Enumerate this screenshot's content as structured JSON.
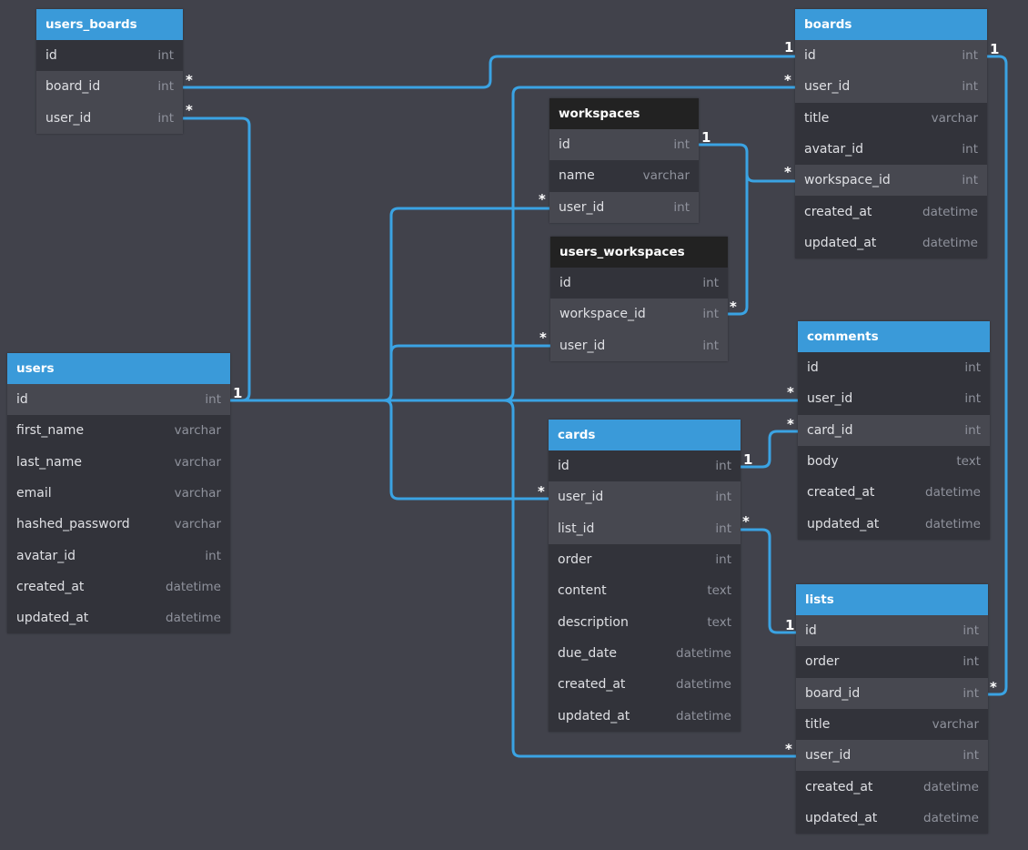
{
  "colors": {
    "background": "#41424b",
    "connector": "#3aa3e3",
    "header_blue": "#3a9ad9",
    "header_dark": "#222222",
    "row_dark": "#32333a",
    "row_light": "#474850"
  },
  "tables": [
    {
      "id": "users_boards",
      "title": "users_boards",
      "header": "blue",
      "fields": [
        {
          "name": "id",
          "type": "int",
          "shade": "dark"
        },
        {
          "name": "board_id",
          "type": "int",
          "shade": "light"
        },
        {
          "name": "user_id",
          "type": "int",
          "shade": "light"
        }
      ]
    },
    {
      "id": "boards",
      "title": "boards",
      "header": "blue",
      "fields": [
        {
          "name": "id",
          "type": "int",
          "shade": "light"
        },
        {
          "name": "user_id",
          "type": "int",
          "shade": "light"
        },
        {
          "name": "title",
          "type": "varchar",
          "shade": "dark"
        },
        {
          "name": "avatar_id",
          "type": "int",
          "shade": "dark"
        },
        {
          "name": "workspace_id",
          "type": "int",
          "shade": "light"
        },
        {
          "name": "created_at",
          "type": "datetime",
          "shade": "dark"
        },
        {
          "name": "updated_at",
          "type": "datetime",
          "shade": "dark"
        }
      ]
    },
    {
      "id": "workspaces",
      "title": "workspaces",
      "header": "dark",
      "fields": [
        {
          "name": "id",
          "type": "int",
          "shade": "light"
        },
        {
          "name": "name",
          "type": "varchar",
          "shade": "dark"
        },
        {
          "name": "user_id",
          "type": "int",
          "shade": "light"
        }
      ]
    },
    {
      "id": "users_workspaces",
      "title": "users_workspaces",
      "header": "dark",
      "fields": [
        {
          "name": "id",
          "type": "int",
          "shade": "dark"
        },
        {
          "name": "workspace_id",
          "type": "int",
          "shade": "light"
        },
        {
          "name": "user_id",
          "type": "int",
          "shade": "light"
        }
      ]
    },
    {
      "id": "users",
      "title": "users",
      "header": "blue",
      "fields": [
        {
          "name": "id",
          "type": "int",
          "shade": "light"
        },
        {
          "name": "first_name",
          "type": "varchar",
          "shade": "dark"
        },
        {
          "name": "last_name",
          "type": "varchar",
          "shade": "dark"
        },
        {
          "name": "email",
          "type": "varchar",
          "shade": "dark"
        },
        {
          "name": "hashed_password",
          "type": "varchar",
          "shade": "dark"
        },
        {
          "name": "avatar_id",
          "type": "int",
          "shade": "dark"
        },
        {
          "name": "created_at",
          "type": "datetime",
          "shade": "dark"
        },
        {
          "name": "updated_at",
          "type": "datetime",
          "shade": "dark"
        }
      ]
    },
    {
      "id": "comments",
      "title": "comments",
      "header": "blue",
      "fields": [
        {
          "name": "id",
          "type": "int",
          "shade": "dark"
        },
        {
          "name": "user_id",
          "type": "int",
          "shade": "dark"
        },
        {
          "name": "card_id",
          "type": "int",
          "shade": "light"
        },
        {
          "name": "body",
          "type": "text",
          "shade": "dark"
        },
        {
          "name": "created_at",
          "type": "datetime",
          "shade": "dark"
        },
        {
          "name": "updated_at",
          "type": "datetime",
          "shade": "dark"
        }
      ]
    },
    {
      "id": "cards",
      "title": "cards",
      "header": "blue",
      "fields": [
        {
          "name": "id",
          "type": "int",
          "shade": "dark"
        },
        {
          "name": "user_id",
          "type": "int",
          "shade": "light"
        },
        {
          "name": "list_id",
          "type": "int",
          "shade": "light"
        },
        {
          "name": "order",
          "type": "int",
          "shade": "dark"
        },
        {
          "name": "content",
          "type": "text",
          "shade": "dark"
        },
        {
          "name": "description",
          "type": "text",
          "shade": "dark"
        },
        {
          "name": "due_date",
          "type": "datetime",
          "shade": "dark"
        },
        {
          "name": "created_at",
          "type": "datetime",
          "shade": "dark"
        },
        {
          "name": "updated_at",
          "type": "datetime",
          "shade": "dark"
        }
      ]
    },
    {
      "id": "lists",
      "title": "lists",
      "header": "blue",
      "fields": [
        {
          "name": "id",
          "type": "int",
          "shade": "light"
        },
        {
          "name": "order",
          "type": "int",
          "shade": "dark"
        },
        {
          "name": "board_id",
          "type": "int",
          "shade": "light"
        },
        {
          "name": "title",
          "type": "varchar",
          "shade": "dark"
        },
        {
          "name": "user_id",
          "type": "int",
          "shade": "light"
        },
        {
          "name": "created_at",
          "type": "datetime",
          "shade": "dark"
        },
        {
          "name": "updated_at",
          "type": "datetime",
          "shade": "dark"
        }
      ]
    }
  ],
  "relations": [
    {
      "from": "users_boards.board_id",
      "to": "boards.id",
      "from_card": "*",
      "to_card": "1"
    },
    {
      "from": "users_boards.user_id",
      "to": "users.id",
      "from_card": "*",
      "to_card": "1"
    },
    {
      "from": "workspaces.id",
      "to": "boards.workspace_id",
      "from_card": "1",
      "to_card": "*"
    },
    {
      "from": "users_workspaces.workspace_id",
      "to": "workspaces.id",
      "from_card": "*",
      "to_card": "1"
    },
    {
      "from": "users.id",
      "to": "workspaces.user_id",
      "from_card": "1",
      "to_card": "*"
    },
    {
      "from": "users.id",
      "to": "users_workspaces.user_id",
      "from_card": "1",
      "to_card": "*"
    },
    {
      "from": "users.id",
      "to": "cards.user_id",
      "from_card": "1",
      "to_card": "*"
    },
    {
      "from": "users.id",
      "to": "comments.user_id",
      "from_card": "1",
      "to_card": "*"
    },
    {
      "from": "users.id",
      "to": "boards.user_id",
      "from_card": "1",
      "to_card": "*"
    },
    {
      "from": "users.id",
      "to": "lists.user_id",
      "from_card": "1",
      "to_card": "*"
    },
    {
      "from": "cards.id",
      "to": "comments.card_id",
      "from_card": "1",
      "to_card": "*"
    },
    {
      "from": "cards.list_id",
      "to": "lists.id",
      "from_card": "*",
      "to_card": "1"
    },
    {
      "from": "boards.id",
      "to": "lists.board_id",
      "from_card": "1",
      "to_card": "*"
    }
  ]
}
